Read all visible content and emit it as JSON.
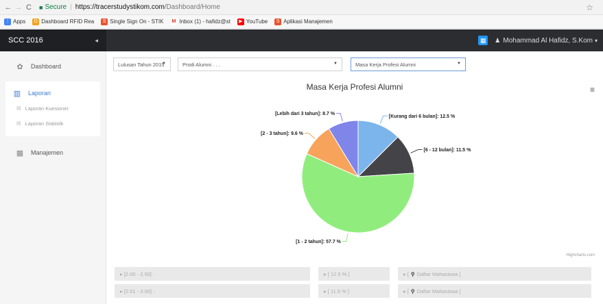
{
  "browser": {
    "secure_label": "Secure",
    "url_host": "https://tracerstudystikom.com",
    "url_path": "/Dashboard/Home",
    "bookmarks": [
      {
        "label": "Apps",
        "color": "#4285f4"
      },
      {
        "label": "Dashboard RFID Rea",
        "color": "#f4a31c"
      },
      {
        "label": "Single Sign On - STIK",
        "color": "#e8542f"
      },
      {
        "label": "Inbox (1) - hafidz@st",
        "color": "#d93025"
      },
      {
        "label": "YouTube",
        "color": "#ff0000"
      },
      {
        "label": "Aplikasi Manajemen",
        "color": "#e8542f"
      }
    ]
  },
  "header": {
    "brand": "SCC 2016",
    "user": "Mohammad Al Hafidz, S.Kom"
  },
  "sidebar": {
    "dashboard": "Dashboard",
    "laporan": "Laporan",
    "laporan_kuesioner": "Laporan Kuesioner",
    "laporan_statistik": "Laporan Statistik",
    "manajemen": "Manajemen"
  },
  "filters": {
    "lulusan": "Lulusan Tahun 2015",
    "prodi": "Prodi Alumni . . .",
    "kategori": "Masa Kerja Profesi Alumni"
  },
  "chart_data": {
    "type": "pie",
    "title": "Masa Kerja Profesi Alumni",
    "credits": "Highcharts.com",
    "slices": [
      {
        "name": "[Kurang dari 6 bulan]",
        "value": 12.5,
        "label": "[Kurang dari 6 bulan]: 12.5 %",
        "color": "#7cb5ec"
      },
      {
        "name": "[6 - 12 bulan]",
        "value": 11.5,
        "label": "[6 - 12 bulan]: 11.5 %",
        "color": "#434348"
      },
      {
        "name": "[1 - 2 tahun]",
        "value": 57.7,
        "label": "[1 - 2 tahun]: 57.7 %",
        "color": "#90ed7d"
      },
      {
        "name": "[2 - 3 tahun]",
        "value": 9.6,
        "label": "[2 - 3 tahun]: 9.6 %",
        "color": "#f7a35c"
      },
      {
        "name": "[Lebih dari 3 tahun]",
        "value": 8.7,
        "label": "[Lebih dari 3 tahun]: 8.7 %",
        "color": "#8085e9"
      }
    ]
  },
  "table": {
    "rows": [
      {
        "range": "▸ [2.00 - 2.50] :",
        "pct": "▸ [ 12.5 % ]",
        "link": "Daftar Mahasiswa"
      },
      {
        "range": "▸ [2.51 - 3.00] :",
        "pct": "▸ [ 11.5 % ]",
        "link": "Daftar Mahasiswa"
      }
    ]
  }
}
